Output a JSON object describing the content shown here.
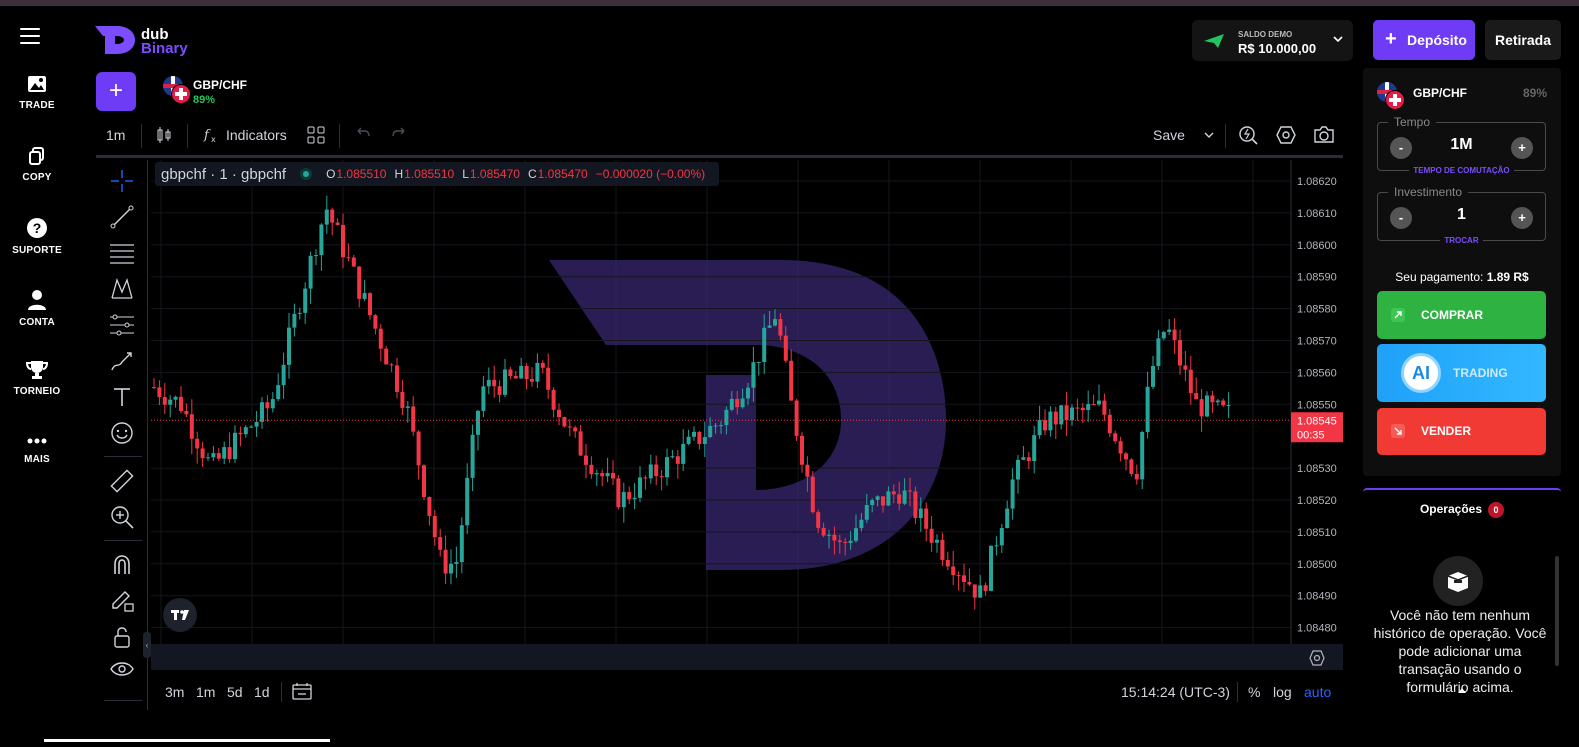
{
  "nav": {
    "items": [
      {
        "label": "TRADE",
        "icon": "image-icon"
      },
      {
        "label": "COPY",
        "icon": "copy-icon"
      },
      {
        "label": "SUPORTE",
        "icon": "help-icon"
      },
      {
        "label": "CONTA",
        "icon": "user-icon"
      },
      {
        "label": "TORNEIO",
        "icon": "trophy-icon"
      },
      {
        "label": "MAIS",
        "icon": "more-icon"
      }
    ]
  },
  "brand": {
    "word1": "dub",
    "word2": "Binary",
    "accent": "#6e3cf5"
  },
  "asset_tab": {
    "name": "GBP/CHF",
    "payout": "89%"
  },
  "account": {
    "label": "SALDO DEMO",
    "balance": "R$ 10.000,00"
  },
  "header": {
    "deposit_label": "Depósito",
    "withdraw_label": "Retirada"
  },
  "chart_toolbar": {
    "interval": "1m",
    "indicators_label": "Indicators",
    "save_label": "Save"
  },
  "legend": {
    "symbol": "gbpchf · 1 · gbpchf",
    "open_key": "O",
    "open": "1.085510",
    "high_key": "H",
    "high": "1.085510",
    "low_key": "L",
    "low": "1.085470",
    "close_key": "C",
    "close": "1.085470",
    "change": "−0.000020 (−0.00%)"
  },
  "price_axis": {
    "ticks": [
      "1.08620",
      "1.08610",
      "1.08600",
      "1.08590",
      "1.08580",
      "1.08570",
      "1.08560",
      "1.08550",
      "1.08530",
      "1.08520",
      "1.08510",
      "1.08500",
      "1.08490",
      "1.08480"
    ],
    "current_price": "1.08545",
    "countdown": "00:35"
  },
  "bottom_bar": {
    "ranges": [
      "3m",
      "1m",
      "5d",
      "1d"
    ],
    "time": "15:14:24 (UTC-3)",
    "percent_label": "%",
    "log_label": "log",
    "auto_label": "auto"
  },
  "trade_panel": {
    "asset": "GBP/CHF",
    "payout": "89%",
    "time_label": "Tempo",
    "time_value": "1M",
    "time_sub": "TEMPO DE COMUTAÇÃO",
    "invest_label": "Investimento",
    "invest_value": "1",
    "invest_sub": "TROCAR",
    "minus": "-",
    "plus": "+",
    "payment_label": "Seu pagamento:",
    "payment_value": "1.89 R$",
    "buy_label": "COMPRAR",
    "ai_badge": "AI",
    "ai_label": "TRADING",
    "sell_label": "VENDER"
  },
  "operations": {
    "title": "Operações",
    "count": "0",
    "empty_message": "Você não tem nenhum histórico de operação. Você pode adicionar uma transação usando o formulário acima."
  },
  "colors": {
    "up": "#26a69a",
    "down": "#f23645",
    "buy": "#2eb342",
    "sell": "#f23a35",
    "ai": "#1ea1f8"
  }
}
